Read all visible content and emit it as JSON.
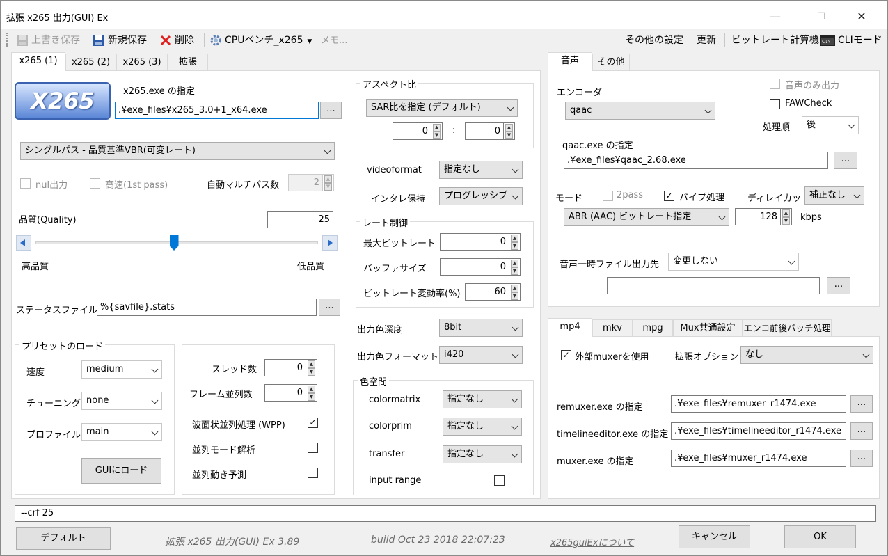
{
  "window": {
    "title": "拡張 x265 出力(GUI) Ex",
    "minimize": "—",
    "maximize": "☐",
    "close": "✕"
  },
  "toolbar": {
    "overwrite_save": "上書き保存",
    "new_save": "新規保存",
    "delete": "削除",
    "cpu_bench": "CPUベンチ_x265",
    "memo": "メモ...",
    "other_settings": "その他の設定",
    "update": "更新",
    "bitrate_calc": "ビットレート計算機",
    "cli_mode": "CLIモード"
  },
  "video_tabs": [
    "x265 (1)",
    "x265 (2)",
    "x265 (3)",
    "拡張"
  ],
  "video": {
    "logo_text": "X265",
    "exe_label": "x265.exe の指定",
    "exe_path": ".¥exe_files¥x265_3.0+1_x64.exe",
    "browse": "...",
    "mode": "シングルパス - 品質基準VBR(可変レート)",
    "nul_output": "nul出力",
    "fast_first_pass": "高速(1st pass)",
    "auto_multipass_label": "自動マルチパス数",
    "auto_multipass_value": "2",
    "quality_label": "品質(Quality)",
    "quality_value": "25",
    "quality_slider_value": 25,
    "quality_slider_min": 0,
    "quality_slider_max": 51,
    "high_quality": "高品質",
    "low_quality": "低品質",
    "status_file_label": "ステータスファイル",
    "status_file_value": "%{savfile}.stats"
  },
  "preset": {
    "group": "プリセットのロード",
    "speed_label": "速度",
    "speed_value": "medium",
    "tuning_label": "チューニング",
    "tuning_value": "none",
    "profile_label": "プロファイル",
    "profile_value": "main",
    "load_button": "GUIにロード"
  },
  "threads": {
    "threads_label": "スレッド数",
    "threads_value": "0",
    "frame_threads_label": "フレーム並列数",
    "frame_threads_value": "0",
    "wpp_label": "波面状並列処理 (WPP)",
    "wpp_checked": "✓",
    "pmode_label": "並列モード解析",
    "pme_label": "並列動き予測"
  },
  "aspect": {
    "group": "アスペクト比",
    "sar_mode": "SAR比を指定 (デフォルト)",
    "sar_x": "0",
    "colon": ":",
    "sar_y": "0"
  },
  "vui": {
    "videoformat_label": "videoformat",
    "videoformat_value": "指定なし",
    "interlace_label": "インタレ保持",
    "interlace_value": "プログレッシブ"
  },
  "rate": {
    "group": "レート制御",
    "max_bitrate_label": "最大ビットレート",
    "max_bitrate_value": "0",
    "buffer_label": "バッファサイズ",
    "buffer_value": "0",
    "variance_label": "ビットレート変動率(%)",
    "variance_value": "60"
  },
  "color": {
    "depth_label": "出力色深度",
    "depth_value": "8bit",
    "format_label": "出力色フォーマット",
    "format_value": "i420",
    "space_group": "色空間",
    "colormatrix_label": "colormatrix",
    "colormatrix_value": "指定なし",
    "colorprim_label": "colorprim",
    "colorprim_value": "指定なし",
    "transfer_label": "transfer",
    "transfer_value": "指定なし",
    "input_range_label": "input range"
  },
  "audio_tabs": [
    "音声",
    "その他"
  ],
  "audio": {
    "encoder_label": "エンコーダ",
    "encoder_value": "qaac",
    "audio_only": "音声のみ出力",
    "faw_check": "FAWCheck",
    "order_label": "処理順",
    "order_value": "後",
    "exe_label": "qaac.exe の指定",
    "exe_path": ".¥exe_files¥qaac_2.68.exe",
    "mode_label": "モード",
    "two_pass": "2pass",
    "pipe_label": "パイプ処理",
    "pipe_checked": "✓",
    "delay_label": "ディレイカット",
    "delay_value": "補正なし",
    "abr_mode": "ABR (AAC) ビットレート指定",
    "bitrate_value": "128",
    "kbps": "kbps",
    "temp_label": "音声一時ファイル出力先",
    "temp_value": "変更しない",
    "temp_path": ""
  },
  "mux_tabs": [
    "mp4",
    "mkv",
    "mpg",
    "Mux共通設定",
    "エンコ前後バッチ処理"
  ],
  "mux": {
    "external_label": "外部muxerを使用",
    "external_checked": "✓",
    "ext_option_label": "拡張オプション",
    "ext_option_value": "なし",
    "remuxer_label": "remuxer.exe の指定",
    "remuxer_path": ".¥exe_files¥remuxer_r1474.exe",
    "timeline_label": "timelineeditor.exe の指定",
    "timeline_path": ".¥exe_files¥timelineeditor_r1474.exe",
    "muxer_label": "muxer.exe の指定",
    "muxer_path": ".¥exe_files¥muxer_r1474.exe"
  },
  "status_cmd": "--crf 25",
  "footer": {
    "default_button": "デフォルト",
    "version": "拡張 x265 出力(GUI) Ex 3.89",
    "build": "build Oct 23 2018 22:07:23",
    "about_link": "x265guiExについて",
    "cancel": "キャンセル",
    "ok": "OK"
  },
  "colors": {
    "accent": "#0078d7",
    "slider_thumb": "#0078d7",
    "link": "#6b6b6b"
  }
}
